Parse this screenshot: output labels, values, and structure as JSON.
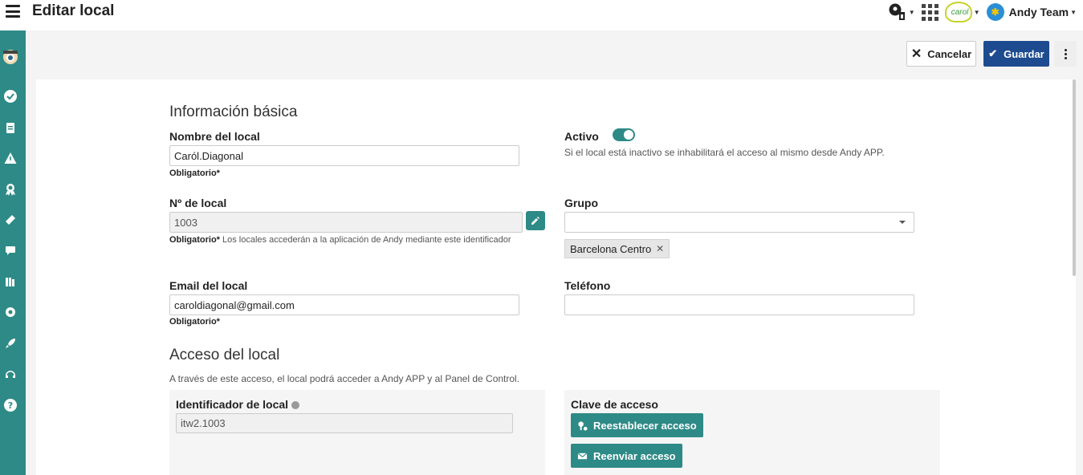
{
  "header": {
    "title": "Editar local",
    "user_name": "Andy Team"
  },
  "actions": {
    "cancel_label": "Cancelar",
    "save_label": "Guardar"
  },
  "basic_info": {
    "section_title": "Información básica",
    "name_label": "Nombre del local",
    "name_value": "Caról.Diagonal",
    "name_hint_required": "Obligatorio*",
    "active_label": "Activo",
    "active_on": true,
    "active_hint": "Si el local está inactivo se inhabilitará el acceso al mismo desde Andy APP.",
    "number_label": "Nº de local",
    "number_value": "1003",
    "number_hint_required": "Obligatorio*",
    "number_hint_text": " Los locales accederán a la aplicación de Andy mediante este identificador",
    "group_label": "Grupo",
    "group_value": "",
    "group_chip": "Barcelona Centro",
    "email_label": "Email del local",
    "email_value": "caroldiagonal@gmail.com",
    "email_hint_required": "Obligatorio*",
    "phone_label": "Teléfono",
    "phone_value": ""
  },
  "access": {
    "section_title": "Acceso del local",
    "description": "A través de este acceso, el local podrá acceder a Andy APP y al Panel de Control.",
    "identifier_label": "Identificador de local",
    "identifier_value": "itw2.1003",
    "key_label": "Clave de acceso",
    "reset_label": "Reestablecer acceso",
    "resend_label": "Reenviar acceso"
  },
  "colors": {
    "sidebar": "#2e8a86",
    "primary": "#1e4b8f",
    "accent": "#2e8a86"
  }
}
